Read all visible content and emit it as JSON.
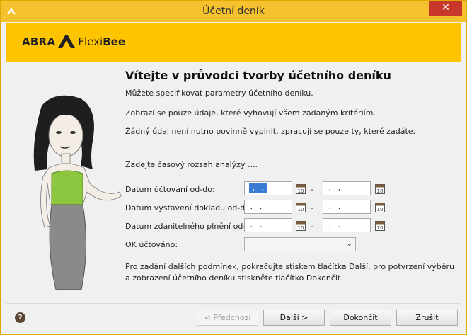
{
  "window": {
    "title": "Účetní deník",
    "close_glyph": "✕"
  },
  "banner": {
    "logo_part1": "ABRA",
    "logo_part2": "Flexi",
    "logo_part3": "Bee",
    "brand_color": "#ffc400"
  },
  "content": {
    "heading": "Vítejte v průvodci tvorby účetního deníku",
    "intro1": "Můžete specifikovat parametry účetního deníku.",
    "intro2": "Zobrazí se pouze údaje, které vyhovují všem zadaným kritériím.",
    "intro3": "Žádný údaj není nutno povinně vyplnit, zpracují se pouze ty, které zadáte.",
    "range_prompt": "Zadejte časový rozsah analýzy ....",
    "rows": [
      {
        "label": "Datum účtování od-do:",
        "from": ". .",
        "to": ". ."
      },
      {
        "label": "Datum vystavení dokladu od-do:",
        "from": ". .",
        "to": ". ."
      },
      {
        "label": "Datum zdanitelného plnění od-do:",
        "from": ". .",
        "to": ". ."
      }
    ],
    "dash": "-",
    "ok_label": "OK účtováno:",
    "ok_value": "",
    "note": "Pro zadání dalších podmínek, pokračujte stiskem tlačítka Další, pro potvrzení výběru a zobrazení účetního deníku stiskněte tlačítko Dokončit."
  },
  "footer": {
    "help_glyph": "?",
    "prev": "< Předchozí",
    "next": "Další >",
    "finish": "Dokončit",
    "cancel": "Zrušit"
  }
}
